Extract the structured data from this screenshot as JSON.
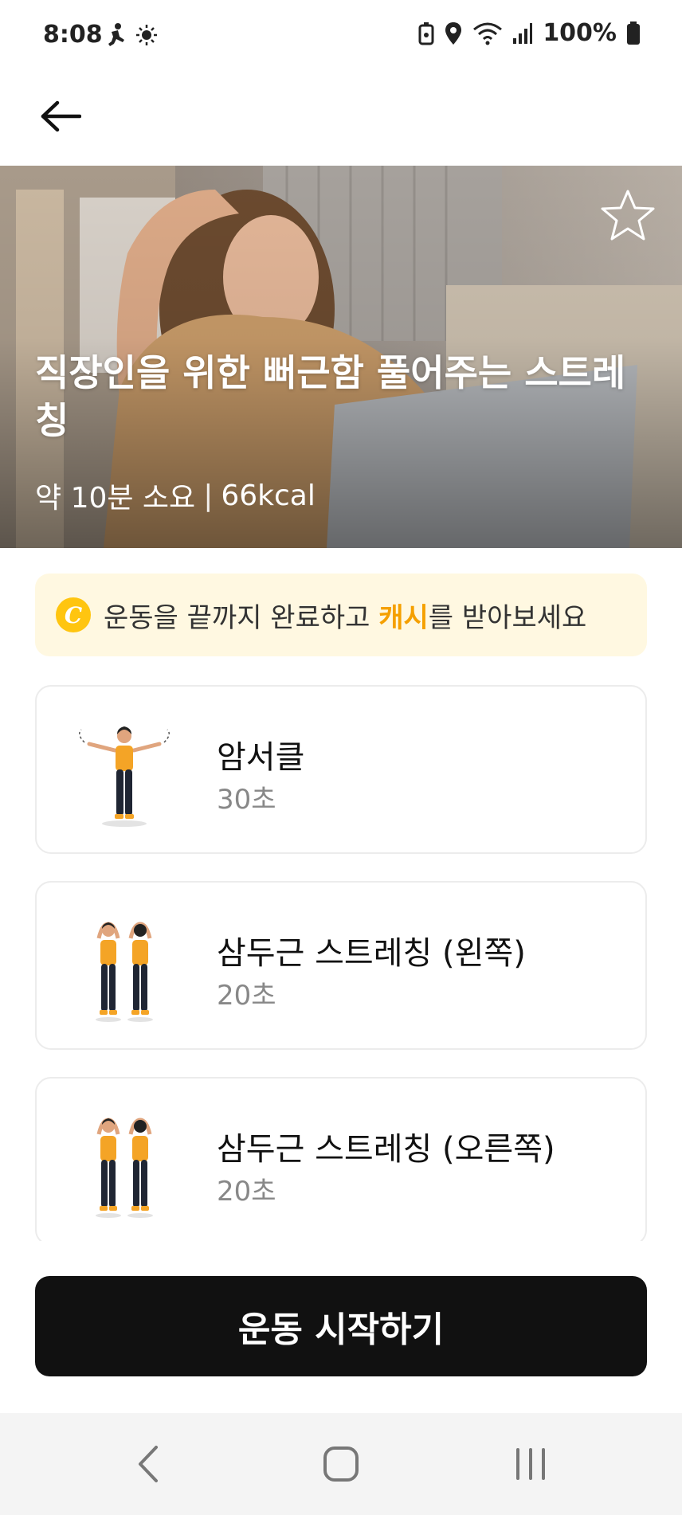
{
  "status_bar": {
    "time": "8:08",
    "battery": "100%",
    "icons": [
      "runner-icon",
      "brightness-icon",
      "battery-saver-icon",
      "location-icon",
      "wifi-icon",
      "signal-icon",
      "battery-icon"
    ]
  },
  "header": {
    "back_icon": "arrow-left-icon"
  },
  "hero": {
    "title": "직장인을 위한 뻐근함 풀어주는 스트레칭",
    "duration": "약 10분 소요",
    "separator": "|",
    "calories": "66kcal",
    "favorite_icon": "star-outline-icon"
  },
  "reward_banner": {
    "coin_symbol": "C",
    "text_before": "운동을 끝까지 완료하고 ",
    "highlight": "캐시",
    "text_after": "를 받아보세요",
    "accent_color": "#f5a000"
  },
  "exercises": [
    {
      "name": "암서클",
      "duration": "30초"
    },
    {
      "name": "삼두근 스트레칭 (왼쪽)",
      "duration": "20초"
    },
    {
      "name": "삼두근 스트레칭 (오른쪽)",
      "duration": "20초"
    }
  ],
  "start_button": {
    "label": "운동 시작하기"
  },
  "nav_bar": {
    "icons": [
      "back-nav-icon",
      "home-nav-icon",
      "recents-nav-icon"
    ]
  },
  "colors": {
    "primary_button": "#111111",
    "banner_bg": "#fff8e1",
    "coin": "#ffc510"
  }
}
